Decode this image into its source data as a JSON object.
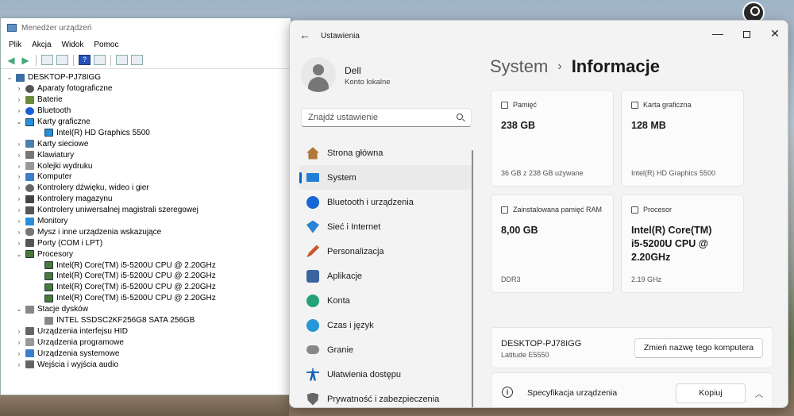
{
  "device_manager": {
    "title": "Menedżer urządzeń",
    "menu": [
      "Plik",
      "Akcja",
      "Widok",
      "Pomoc"
    ],
    "tree": [
      {
        "level": 0,
        "exp": "v",
        "icon": "root",
        "label": "DESKTOP-PJ78IGG"
      },
      {
        "level": 1,
        "exp": ">",
        "icon": "cam",
        "label": "Aparaty fotograficzne"
      },
      {
        "level": 1,
        "exp": ">",
        "icon": "bat",
        "label": "Baterie"
      },
      {
        "level": 1,
        "exp": ">",
        "icon": "bt",
        "label": "Bluetooth"
      },
      {
        "level": 1,
        "exp": "v",
        "icon": "disp",
        "label": "Karty graficzne"
      },
      {
        "level": 2,
        "exp": "",
        "icon": "disp",
        "label": "Intel(R) HD Graphics 5500"
      },
      {
        "level": 1,
        "exp": ">",
        "icon": "net",
        "label": "Karty sieciowe"
      },
      {
        "level": 1,
        "exp": ">",
        "icon": "kbd",
        "label": "Klawiatury"
      },
      {
        "level": 1,
        "exp": ">",
        "icon": "bus",
        "label": "Kolejki wydruku"
      },
      {
        "level": 1,
        "exp": ">",
        "icon": "pc",
        "label": "Komputer"
      },
      {
        "level": 1,
        "exp": ">",
        "icon": "snd",
        "label": "Kontrolery dźwięku, wideo i gier"
      },
      {
        "level": 1,
        "exp": ">",
        "icon": "stor",
        "label": "Kontrolery magazynu"
      },
      {
        "level": 1,
        "exp": ">",
        "icon": "usb",
        "label": "Kontrolery uniwersalnej magistrali szeregowej"
      },
      {
        "level": 1,
        "exp": ">",
        "icon": "mon",
        "label": "Monitory"
      },
      {
        "level": 1,
        "exp": ">",
        "icon": "mouse",
        "label": "Mysz i inne urządzenia wskazujące"
      },
      {
        "level": 1,
        "exp": ">",
        "icon": "port",
        "label": "Porty (COM i LPT)"
      },
      {
        "level": 1,
        "exp": "v",
        "icon": "cpu",
        "label": "Procesory"
      },
      {
        "level": 2,
        "exp": "",
        "icon": "cpu",
        "label": "Intel(R) Core(TM) i5-5200U CPU @ 2.20GHz"
      },
      {
        "level": 2,
        "exp": "",
        "icon": "cpu",
        "label": "Intel(R) Core(TM) i5-5200U CPU @ 2.20GHz"
      },
      {
        "level": 2,
        "exp": "",
        "icon": "cpu",
        "label": "Intel(R) Core(TM) i5-5200U CPU @ 2.20GHz"
      },
      {
        "level": 2,
        "exp": "",
        "icon": "cpu",
        "label": "Intel(R) Core(TM) i5-5200U CPU @ 2.20GHz"
      },
      {
        "level": 1,
        "exp": "v",
        "icon": "disk",
        "label": "Stacje dysków"
      },
      {
        "level": 2,
        "exp": "",
        "icon": "disk",
        "label": "INTEL SSDSC2KF256G8 SATA 256GB"
      },
      {
        "level": 1,
        "exp": ">",
        "icon": "hid",
        "label": "Urządzenia interfejsu HID"
      },
      {
        "level": 1,
        "exp": ">",
        "icon": "bus",
        "label": "Urządzenia programowe"
      },
      {
        "level": 1,
        "exp": ">",
        "icon": "sys",
        "label": "Urządzenia systemowe"
      },
      {
        "level": 1,
        "exp": ">",
        "icon": "aud",
        "label": "Wejścia i wyjścia audio"
      }
    ]
  },
  "settings": {
    "app_title": "Ustawienia",
    "user": {
      "name": "Dell",
      "account_type": "Konto lokalne"
    },
    "search": {
      "placeholder": "Znajdź ustawienie"
    },
    "nav": [
      {
        "label": "Strona główna",
        "icon": "i-home",
        "name": "home"
      },
      {
        "label": "System",
        "icon": "i-sys",
        "name": "system",
        "active": true
      },
      {
        "label": "Bluetooth i urządzenia",
        "icon": "i-bt",
        "name": "bluetooth"
      },
      {
        "label": "Sieć i Internet",
        "icon": "i-net",
        "name": "network"
      },
      {
        "label": "Personalizacja",
        "icon": "i-pers",
        "name": "personalization"
      },
      {
        "label": "Aplikacje",
        "icon": "i-apps",
        "name": "apps"
      },
      {
        "label": "Konta",
        "icon": "i-acc",
        "name": "accounts"
      },
      {
        "label": "Czas i język",
        "icon": "i-time",
        "name": "time-language"
      },
      {
        "label": "Granie",
        "icon": "i-game",
        "name": "gaming"
      },
      {
        "label": "Ułatwienia dostępu",
        "icon": "i-a11y",
        "name": "accessibility"
      },
      {
        "label": "Prywatność i zabezpieczenia",
        "icon": "i-priv",
        "name": "privacy"
      }
    ],
    "breadcrumb": {
      "parent": "System",
      "separator": "›",
      "current": "Informacje"
    },
    "cards": {
      "storage": {
        "label": "Pamięć",
        "value": "238 GB",
        "sub": "36 GB z 238 GB używane"
      },
      "gpu": {
        "label": "Karta graficzna",
        "value": "128 MB",
        "sub": "Intel(R) HD Graphics 5500"
      },
      "ram": {
        "label": "Zainstalowana pamięć RAM",
        "value": "8,00 GB",
        "sub": "DDR3"
      },
      "cpu": {
        "label": "Procesor",
        "value_lines": [
          "Intel(R) Core(TM)",
          "i5-5200U CPU @",
          "2.20GHz"
        ],
        "sub": "2.19 GHz"
      }
    },
    "device": {
      "name": "DESKTOP-PJ78IGG",
      "model": "Latitude E5550",
      "rename_label": "Zmień nazwę tego komputera"
    },
    "spec": {
      "title": "Specyfikacja urządzenia",
      "copy_label": "Kopiuj"
    },
    "window_buttons": {
      "minimize": "—",
      "close": "✕"
    }
  }
}
